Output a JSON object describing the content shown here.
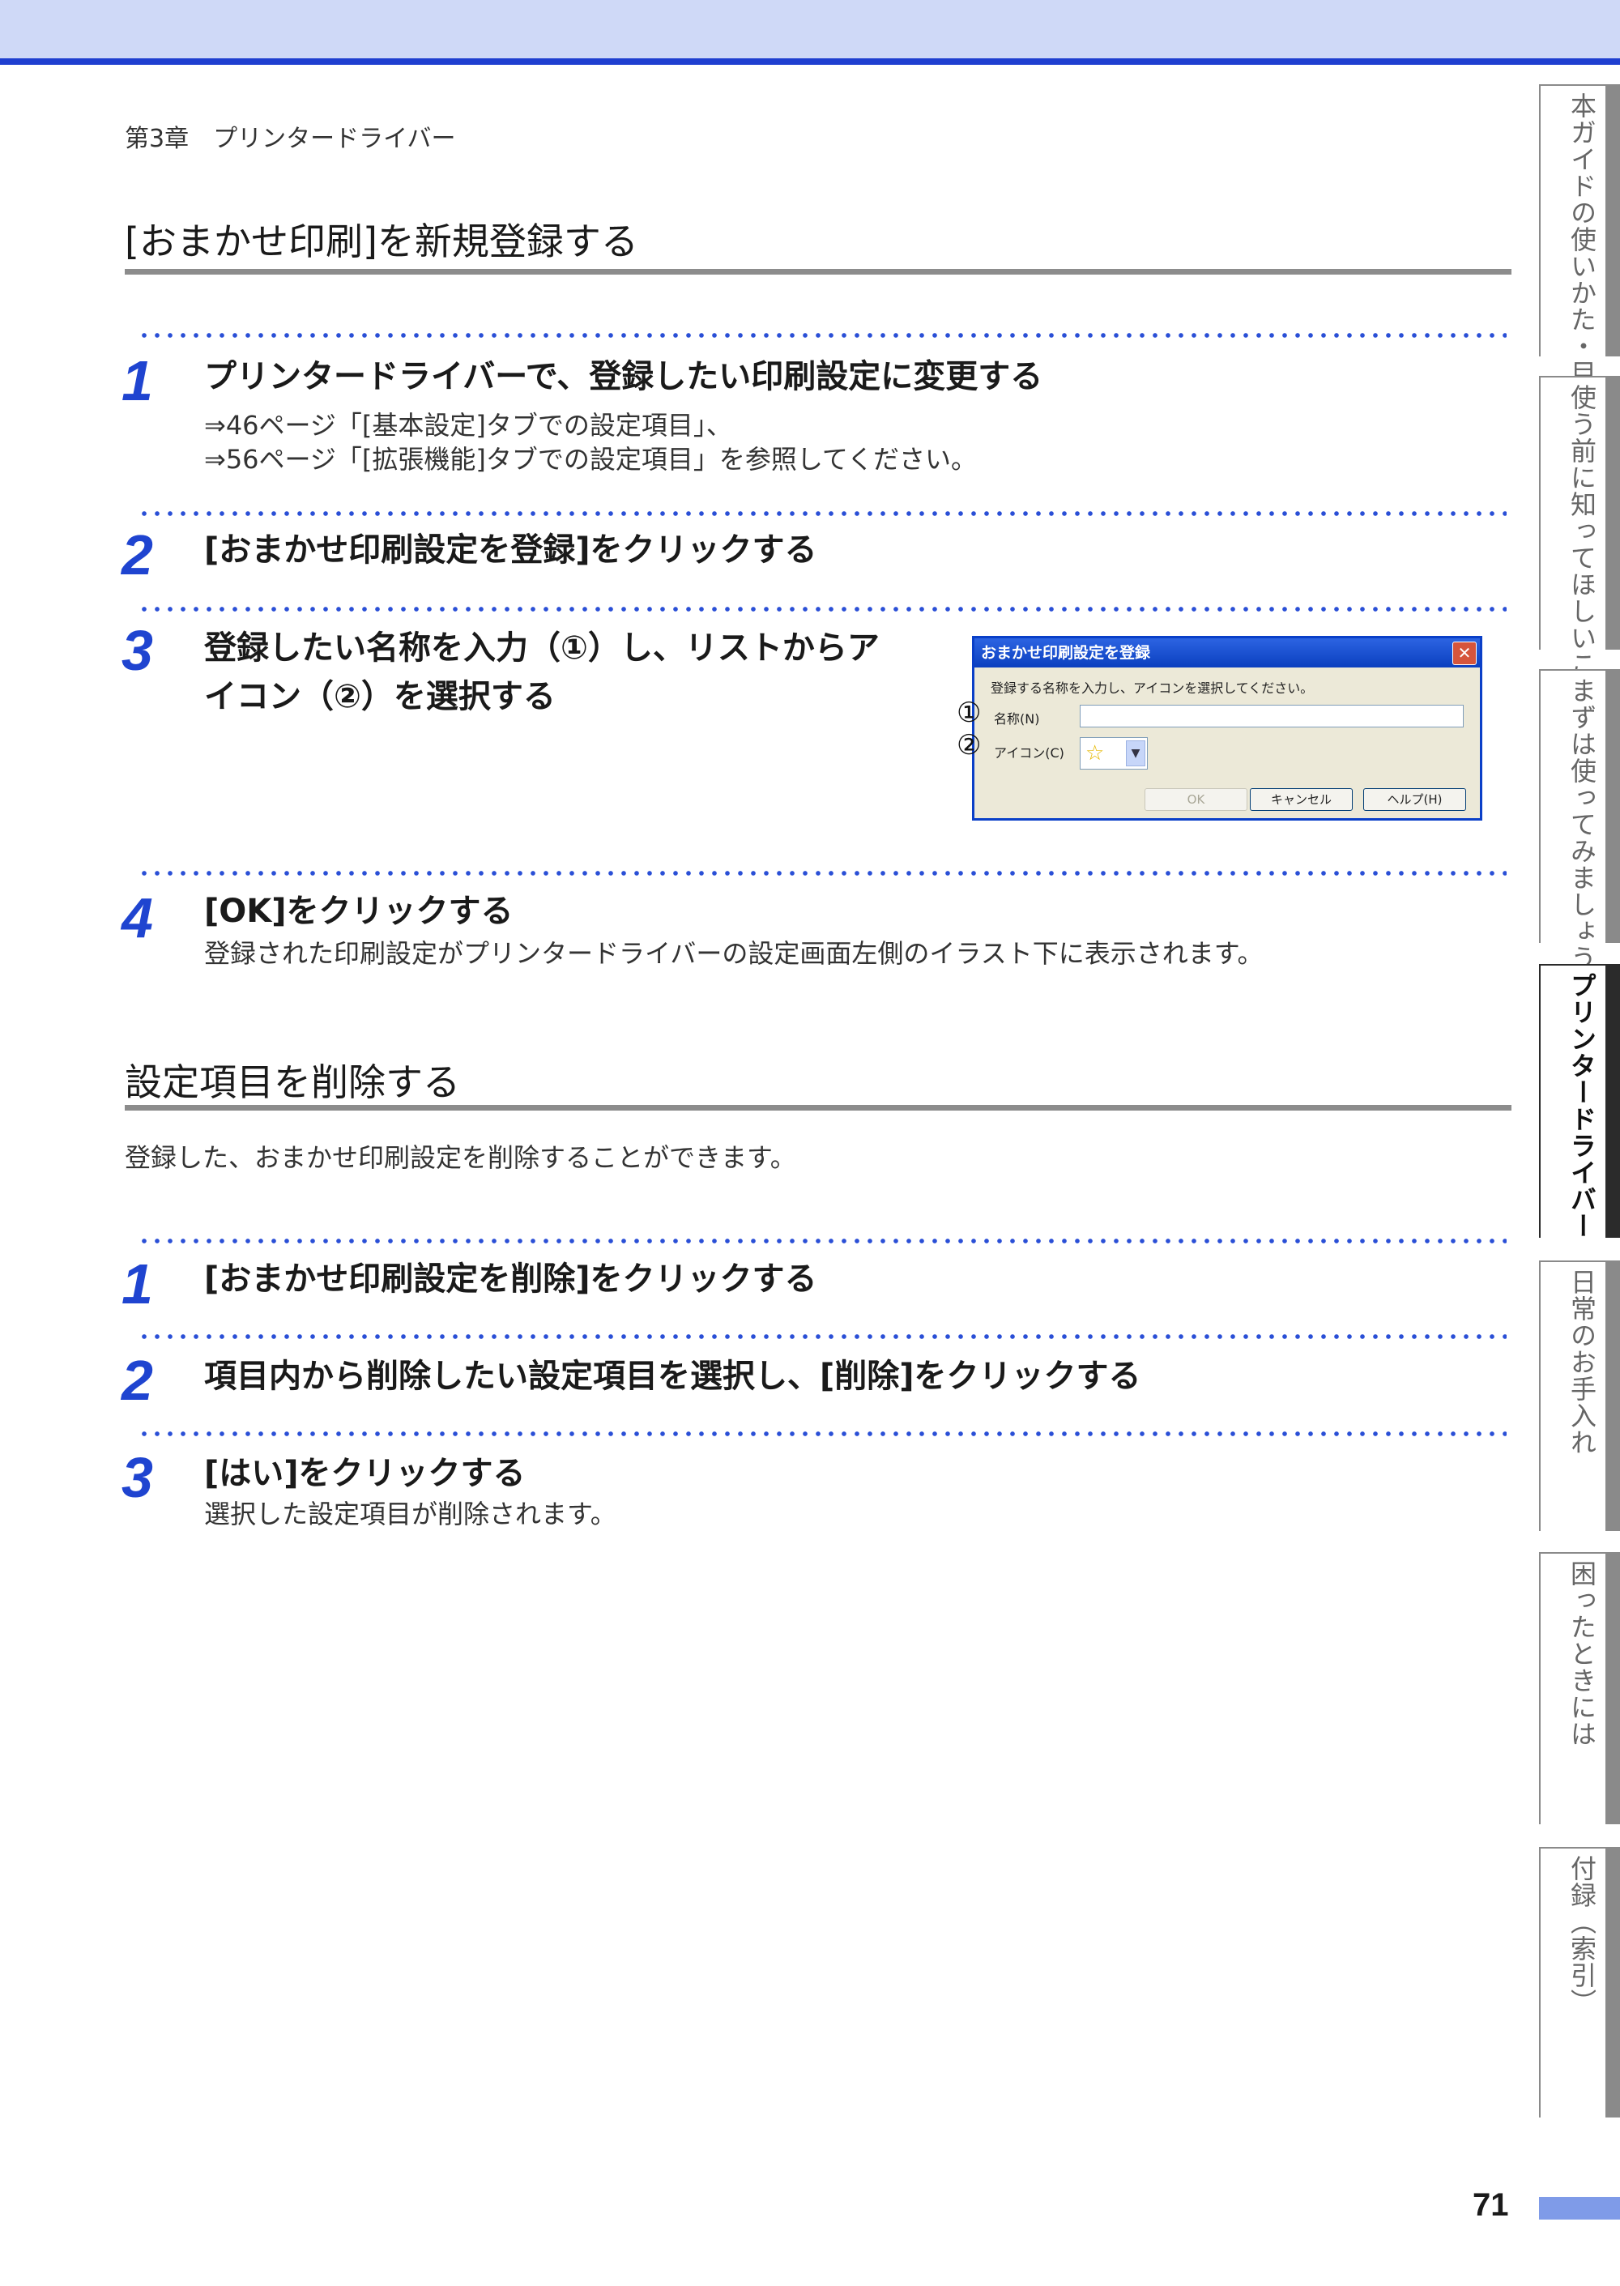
{
  "header": {
    "chapter": "第3章　プリンタードライバー"
  },
  "section1": {
    "title": "[おまかせ印刷]を新規登録する",
    "steps": [
      {
        "num": "1",
        "text": "プリンタードライバーで、登録したい印刷設定に変更する",
        "line1": "⇒46ページ「[基本設定]タブでの設定項目」、",
        "line2": "⇒56ページ「[拡張機能]タブでの設定項目」を参照してください。"
      },
      {
        "num": "2",
        "text": "[おまかせ印刷設定を登録]をクリックする"
      },
      {
        "num": "3",
        "line1": "登録したい名称を入力（①）し、リストからア",
        "line2": "イコン（②）を選択する"
      },
      {
        "num": "4",
        "text": "[OK]をクリックする",
        "desc": "登録された印刷設定がプリンタードライバーの設定画面左側のイラスト下に表示されます。"
      }
    ]
  },
  "dialog": {
    "title": "おまかせ印刷設定を登録",
    "close": "✕",
    "message": "登録する名称を入力し、アイコンを選択してください。",
    "name_label": "名称(N)",
    "icon_label": "アイコン(C)",
    "callout1": "①",
    "callout2": "②",
    "star": "☆",
    "arrow": "▼",
    "ok": "OK",
    "cancel": "キャンセル",
    "help": "ヘルプ(H)"
  },
  "section2": {
    "title": "設定項目を削除する",
    "intro": "登録した、おまかせ印刷設定を削除することができます。",
    "steps": [
      {
        "num": "1",
        "text": "[おまかせ印刷設定を削除]をクリックする"
      },
      {
        "num": "2",
        "text": "項目内から削除したい設定項目を選択し、[削除]をクリックする"
      },
      {
        "num": "3",
        "text": "[はい]をクリックする",
        "desc": "選択した設定項目が削除されます。"
      }
    ]
  },
  "side_tabs": [
    {
      "label": "本ガイドの使いかた・目次"
    },
    {
      "label": "使う前に知ってほしいこと"
    },
    {
      "label": "まずは使ってみましょう"
    },
    {
      "label": "プリンタードライバー",
      "active": true
    },
    {
      "label": "日常のお手入れ"
    },
    {
      "label": "困ったときには"
    },
    {
      "label": "付録（索引）"
    }
  ],
  "page_number": "71",
  "colors": {
    "accent": "#1f44d0",
    "header_band": "#cfd9f7",
    "tab_active": "#2b2b2b",
    "tab_inactive": "#8a8a8a"
  }
}
